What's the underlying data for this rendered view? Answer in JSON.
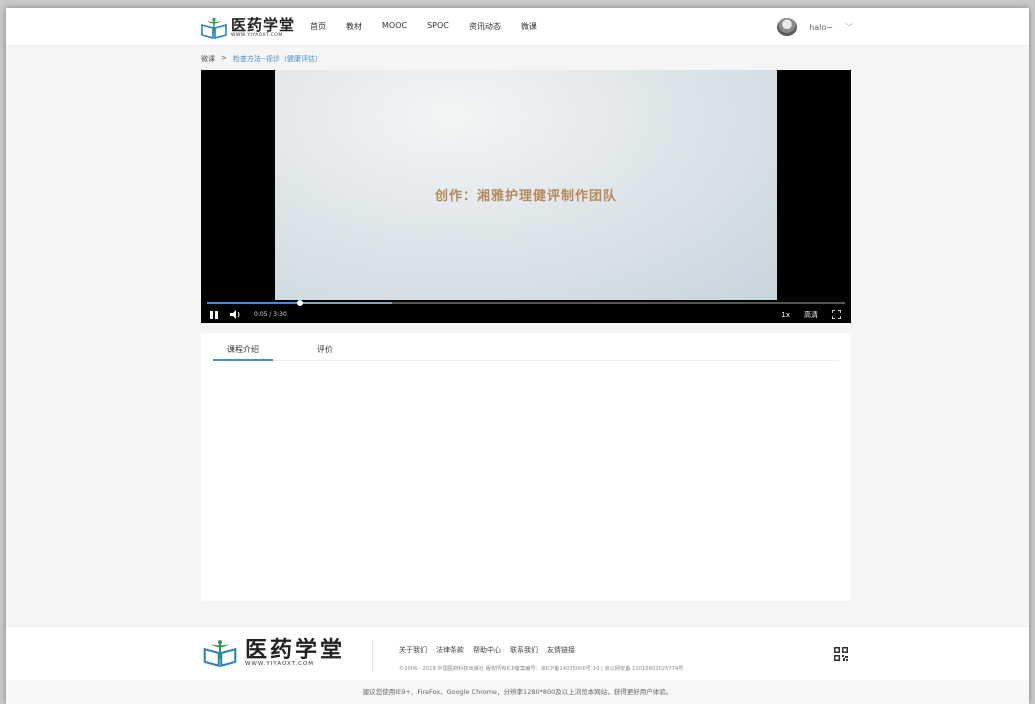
{
  "header": {
    "logo_cn": "医药学堂",
    "logo_en": "WWW.YIYAOXT.COM",
    "nav": [
      "首页",
      "教材",
      "MOOC",
      "SPOC",
      "资讯动态",
      "微课"
    ],
    "username": "halo~",
    "caret": "﹀"
  },
  "breadcrumb": {
    "root": "微课",
    "sep": ">",
    "current": "检查方法--视诊（健康评估）"
  },
  "player": {
    "caption": "创作：湘雅护理健评制作团队",
    "time": "0:05 / 3:30",
    "speed": "1x",
    "quality": "高清",
    "progress": 0.145,
    "buffered": 0.29
  },
  "tabs": [
    "课程介绍",
    "评价"
  ],
  "footer": {
    "logo_cn": "医药学堂",
    "logo_en": "WWW.YIYAOXT.COM",
    "links": [
      "关于我们",
      "法律条款",
      "帮助中心",
      "联系我们",
      "友情链接"
    ],
    "copyright": "©2006 - 2018 中国医药科技出版社 版权所有ICP备案编号：京ICP备14035006号-10 | 京公网安备 11010802025774号",
    "note": "建议您使用IE9+、FireFox、Google Chrome，分辨率1280*800及以上浏览本网站，获得更好用户体验。"
  },
  "colors": {
    "accent": "#3f8fd2",
    "caption": "#b58a5a"
  }
}
